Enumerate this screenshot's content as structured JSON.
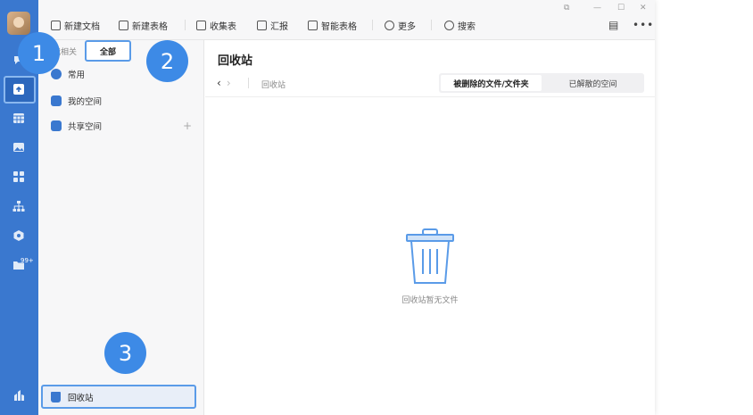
{
  "toolbar": {
    "new_doc": "新建文档",
    "new_sheet": "新建表格",
    "collect_form": "收集表",
    "report": "汇报",
    "smart_sheet": "智能表格",
    "more": "更多",
    "search": "搜索"
  },
  "sidebar": {
    "tab_related": "我相关",
    "tab_all": "全部",
    "items": [
      {
        "label": "常用",
        "icon": "clock-icon"
      },
      {
        "label": "我的空间",
        "icon": "drive-icon"
      },
      {
        "label": "共享空间",
        "icon": "users-icon"
      }
    ],
    "add_symbol": "+",
    "recycle_label": "回收站"
  },
  "rail": {
    "badge": "99+"
  },
  "main": {
    "title": "回收站",
    "breadcrumb": "回收站",
    "seg_deleted": "被删除的文件/文件夹",
    "seg_dissolved": "已解散的空间",
    "empty_text": "回收站暂无文件"
  },
  "callouts": [
    "1",
    "2",
    "3"
  ],
  "colors": {
    "rail": "#3a78cf",
    "accent": "#3d8ae6",
    "highlight_border": "#5a9be8"
  }
}
